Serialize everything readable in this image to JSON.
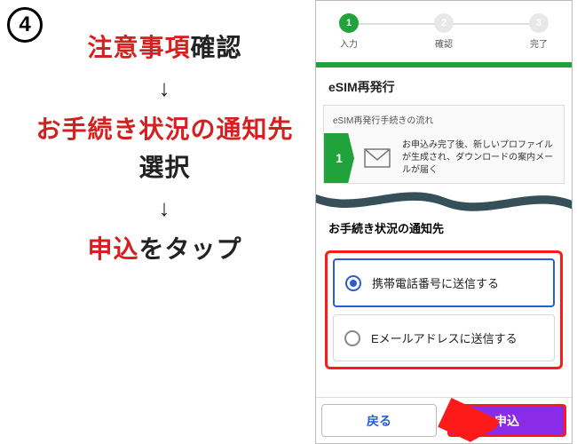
{
  "badge": "4",
  "instructions": {
    "l1_red": "注意事項",
    "l1_blk": "確認",
    "l2_red": "お手続き状況の通知先",
    "l3_blk": "選択",
    "l4_red": "申込",
    "l4_blk": "をタップ"
  },
  "stepper": {
    "s1": {
      "num": "1",
      "label": "入力"
    },
    "s2": {
      "num": "2",
      "label": "確認"
    },
    "s3": {
      "num": "3",
      "label": "完了"
    }
  },
  "screen": {
    "title": "eSIM再発行",
    "flow_head": "eSIM再発行手続きの流れ",
    "flow_num": "1",
    "flow_text": "お申込み完了後、新しいプロファイルが生成され、ダウンロードの案内メールが届く"
  },
  "notify": {
    "title": "お手続き状況の通知先",
    "opt1": "携帯電話番号に送信する",
    "opt2": "Eメールアドレスに送信する"
  },
  "buttons": {
    "back": "戻る",
    "apply": "申込"
  }
}
